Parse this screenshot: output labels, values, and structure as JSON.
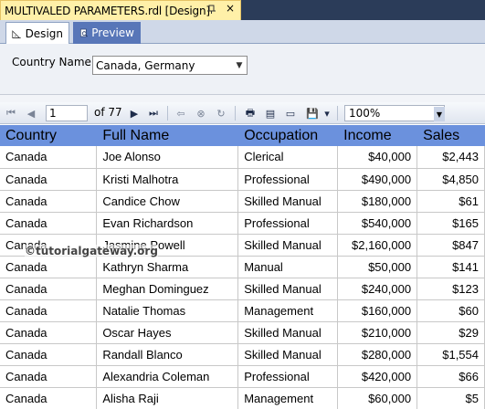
{
  "document_tab": {
    "title": "MULTIVALED PARAMETERS.rdl [Design]",
    "pin_icon": "pin-icon",
    "close_glyph": "×"
  },
  "view_tabs": [
    {
      "label": "Design",
      "icon": "design-icon",
      "active": true
    },
    {
      "label": "Preview",
      "icon": "preview-icon",
      "active": false
    }
  ],
  "parameter": {
    "label": "Country Name",
    "value": "Canada, Germany"
  },
  "toolbar": {
    "page_current": "1",
    "page_of": "of 77",
    "zoom": "100%"
  },
  "table": {
    "headers": [
      "Country",
      "Full Name",
      "Occupation",
      "Income",
      "Sales"
    ],
    "rows": [
      [
        "Canada",
        "Joe Alonso",
        "Clerical",
        "$40,000",
        "$2,443"
      ],
      [
        "Canada",
        "Kristi Malhotra",
        "Professional",
        "$490,000",
        "$4,850"
      ],
      [
        "Canada",
        "Candice Chow",
        "Skilled Manual",
        "$180,000",
        "$61"
      ],
      [
        "Canada",
        "Evan Richardson",
        "Professional",
        "$540,000",
        "$165"
      ],
      [
        "Canada",
        "Jasmine Powell",
        "Skilled Manual",
        "$2,160,000",
        "$847"
      ],
      [
        "Canada",
        "Kathryn Sharma",
        "Manual",
        "$50,000",
        "$141"
      ],
      [
        "Canada",
        "Meghan Dominguez",
        "Skilled Manual",
        "$240,000",
        "$123"
      ],
      [
        "Canada",
        "Natalie Thomas",
        "Management",
        "$160,000",
        "$60"
      ],
      [
        "Canada",
        "Oscar Hayes",
        "Skilled Manual",
        "$210,000",
        "$29"
      ],
      [
        "Canada",
        "Randall Blanco",
        "Skilled Manual",
        "$280,000",
        "$1,554"
      ],
      [
        "Canada",
        "Alexandria Coleman",
        "Professional",
        "$420,000",
        "$66"
      ],
      [
        "Canada",
        "Alisha Raji",
        "Management",
        "$60,000",
        "$5"
      ]
    ]
  },
  "watermark": "©tutorialgateway.org"
}
